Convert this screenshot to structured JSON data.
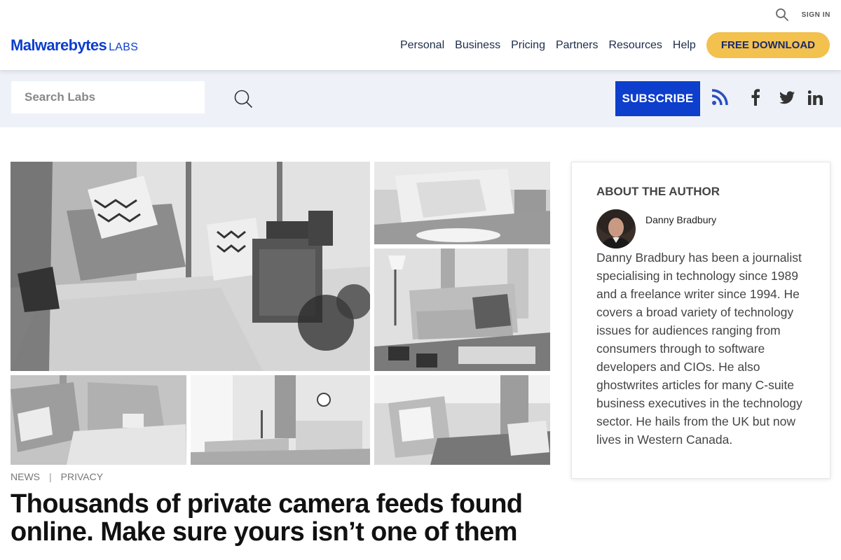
{
  "header": {
    "logo_main": "Malwarebytes",
    "logo_labs": "LABS",
    "sign_in": "SIGN IN",
    "nav": [
      "Personal",
      "Business",
      "Pricing",
      "Partners",
      "Resources",
      "Help"
    ],
    "cta": "FREE DOWNLOAD"
  },
  "search_bar": {
    "placeholder": "Search Labs",
    "subscribe": "SUBSCRIBE"
  },
  "article": {
    "categories": [
      "NEWS",
      "PRIVACY"
    ],
    "separator": "|",
    "title": "Thousands of private camera feeds found online. Make sure yours isn’t one of them"
  },
  "author": {
    "heading": "ABOUT THE AUTHOR",
    "name": "Danny Bradbury",
    "bio": "Danny Bradbury has been a journalist specialising in technology since 1989 and a freelance writer since 1994. He covers a broad variety of technology issues for audiences ranging from consumers through to software developers and CIOs. He also ghostwrites articles for many C-suite business executives in the technology sector. He hails from the UK but now lives in Western Canada."
  },
  "icons": {
    "top_search": "search-icon",
    "search_button": "search-icon",
    "social": [
      "rss-icon",
      "facebook-icon",
      "twitter-icon",
      "linkedin-icon"
    ]
  },
  "colors": {
    "brand_blue": "#0d3ecc",
    "cta_yellow": "#f2c14e",
    "search_band": "#eef2f8",
    "rss_blue": "#2b4fc0"
  }
}
